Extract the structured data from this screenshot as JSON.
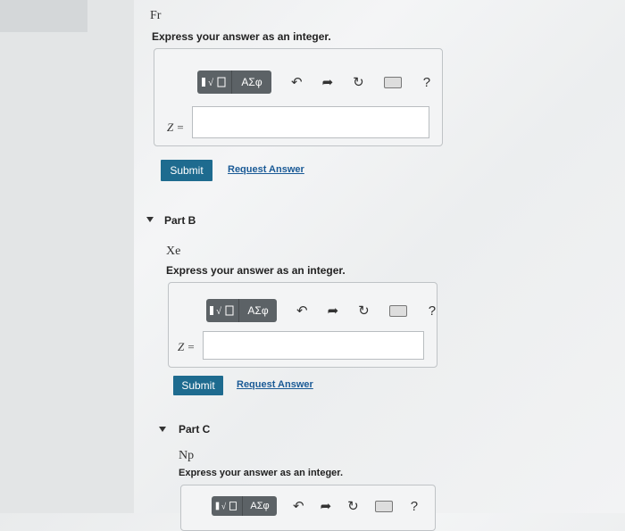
{
  "partA": {
    "element": "Fr",
    "prompt": "Express your answer as an integer.",
    "var_label": "Z =",
    "submit_label": "Submit",
    "request_label": "Request Answer",
    "input_value": ""
  },
  "partB": {
    "title": "Part B",
    "element": "Xe",
    "prompt": "Express your answer as an integer.",
    "var_label": "Z =",
    "submit_label": "Submit",
    "request_label": "Request Answer",
    "input_value": ""
  },
  "partC": {
    "title": "Part C",
    "element": "Np",
    "prompt": "Express your answer as an integer."
  },
  "toolbar": {
    "greek_label": "ΑΣφ",
    "help_label": "?"
  },
  "colors": {
    "submit": "#1e6b8f",
    "link": "#1a5a96",
    "toolbar": "#5c6266"
  }
}
